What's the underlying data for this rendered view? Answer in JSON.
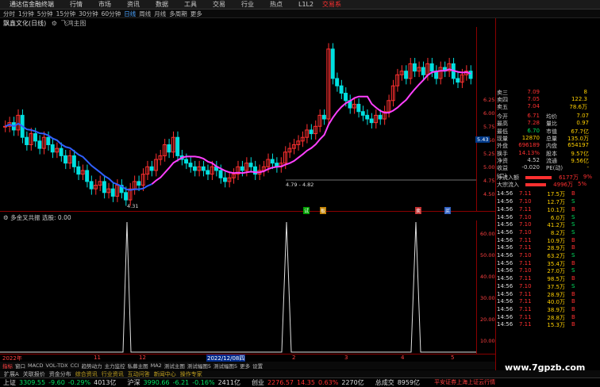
{
  "titlebar": {
    "app": "通达信金融终端",
    "menus": [
      "行情",
      "市场",
      "资讯",
      "数据",
      "工具",
      "交易",
      "行业",
      "热点",
      "L1L2"
    ],
    "right_label": "交易系"
  },
  "periods": [
    "分时",
    "1分钟",
    "5分钟",
    "15分钟",
    "30分钟",
    "60分钟",
    "日线",
    "周线",
    "月线",
    "多周期",
    "更多"
  ],
  "active_period": "日线",
  "stock": {
    "name": "飘鑫文化(日线)",
    "indicator": "飞鸿主图"
  },
  "main_y_ticks": [
    "6.25",
    "6.00",
    "5.75",
    "5.50",
    "5.25",
    "5.00",
    "4.75",
    "4.50"
  ],
  "price_labels": {
    "low": "4.31",
    "range": "4.79 - 4.82",
    "current": "5.43"
  },
  "sub_indicator": {
    "name": "多金叉共振",
    "label": "选股: 0.00"
  },
  "sub_y_ticks": [
    "60.00",
    "50.00",
    "40.00",
    "30.00",
    "20.00",
    "10.00"
  ],
  "signal_marks": [
    "试",
    "板",
    "卖",
    "买"
  ],
  "x_labels": [
    "2022年",
    "11",
    "12",
    "2022/12/08四",
    "2",
    "3",
    "4",
    "5"
  ],
  "quote": {
    "asks": [
      {
        "label": "卖三",
        "price": "7.09",
        "vol": "8"
      },
      {
        "label": "卖四",
        "price": "7.05",
        "vol": "122.3"
      },
      {
        "label": "卖五",
        "price": "7.04",
        "vol": "78.6万"
      }
    ],
    "stats": [
      {
        "l1": "今开",
        "v1": "6.71",
        "l2": "均价",
        "v2": "7.07"
      },
      {
        "l1": "最高",
        "v1": "7.28",
        "l2": "量比",
        "v2": "0.97"
      },
      {
        "l1": "最低",
        "v1": "6.70",
        "l2": "市值",
        "v2": "67.7亿"
      },
      {
        "l1": "现量",
        "v1": "12870",
        "l2": "总量",
        "v2": "135.0万"
      },
      {
        "l1": "外盘",
        "v1": "696189",
        "l2": "内盘",
        "v2": "654197"
      },
      {
        "l1": "换手",
        "v1": "14.13%",
        "l2": "股本",
        "v2": "9.57亿"
      },
      {
        "l1": "净资",
        "v1": "4.52",
        "l2": "流通",
        "v2": "9.56亿"
      },
      {
        "l1": "收益(二)",
        "v1": "-0.020",
        "l2": "PE(动)",
        "v2": "-"
      }
    ],
    "flows": [
      {
        "label": "净流入额",
        "value": "6177万",
        "pct": "9%"
      },
      {
        "label": "大宗流入",
        "value": "4996万",
        "pct": "5%"
      }
    ]
  },
  "ticks": [
    {
      "t": "14:56",
      "p": "7.11",
      "v": "17.5万",
      "bs": "B"
    },
    {
      "t": "14:56",
      "p": "7.10",
      "v": "12.7万",
      "bs": "S"
    },
    {
      "t": "14:56",
      "p": "7.11",
      "v": "10.1万",
      "bs": "B"
    },
    {
      "t": "14:56",
      "p": "7.10",
      "v": "6.0万",
      "bs": "S"
    },
    {
      "t": "14:56",
      "p": "7.10",
      "v": "41.2万",
      "bs": "S"
    },
    {
      "t": "14:56",
      "p": "7.10",
      "v": "8.2万",
      "bs": "S"
    },
    {
      "t": "14:56",
      "p": "7.11",
      "v": "10.9万",
      "bs": "B"
    },
    {
      "t": "14:56",
      "p": "7.11",
      "v": "28.9万",
      "bs": "B"
    },
    {
      "t": "14:56",
      "p": "7.10",
      "v": "63.2万",
      "bs": "S"
    },
    {
      "t": "14:56",
      "p": "7.11",
      "v": "35.4万",
      "bs": "B"
    },
    {
      "t": "14:56",
      "p": "7.10",
      "v": "27.0万",
      "bs": "S"
    },
    {
      "t": "14:56",
      "p": "7.11",
      "v": "98.5万",
      "bs": "B"
    },
    {
      "t": "14:56",
      "p": "7.10",
      "v": "37.5万",
      "bs": "S"
    },
    {
      "t": "14:56",
      "p": "7.11",
      "v": "28.9万",
      "bs": "B"
    },
    {
      "t": "14:56",
      "p": "7.11",
      "v": "40.0万",
      "bs": "B"
    },
    {
      "t": "14:56",
      "p": "7.11",
      "v": "38.9万",
      "bs": "B"
    },
    {
      "t": "14:56",
      "p": "7.11",
      "v": "28.8万",
      "bs": "B"
    },
    {
      "t": "14:56",
      "p": "7.11",
      "v": "15.3万",
      "bs": "B"
    }
  ],
  "ind_tabs": [
    "指标",
    "窗口",
    "MACD",
    "VOL-TDX",
    "CCI",
    "趋势动力",
    "主力监控",
    "私募主图",
    "MA2",
    "测试主图",
    "测试幅图5",
    "测试幅图5",
    "更多",
    "设置"
  ],
  "bottom_tabs": [
    "扩展A",
    "关联报价",
    "资金分布",
    "综合资讯",
    "行业资讯",
    "互动问答",
    "新闻中心",
    "操作专家"
  ],
  "indexbar": [
    {
      "name": "上证",
      "val": "3309.55",
      "chg": "-9.60",
      "pct": "-0.29%",
      "amt": "4013亿"
    },
    {
      "name": "沪深",
      "val": "3990.66",
      "chg": "-6.21",
      "pct": "-0.16%",
      "amt": "2411亿"
    },
    {
      "name": "创业",
      "val": "2276.57",
      "chg": "14.35",
      "pct": "0.63%",
      "amt": "2270亿"
    },
    {
      "name": "总成交",
      "val": "8959亿",
      "chg": "",
      "pct": "",
      "amt": ""
    }
  ],
  "broker": "平安证券上海上证云行情",
  "watermark": "www.7gpzb.com",
  "colors": {
    "up": "#ff3030",
    "down": "#00e0e0",
    "ma": "#ff40ff",
    "ma2": "#3060ff"
  }
}
